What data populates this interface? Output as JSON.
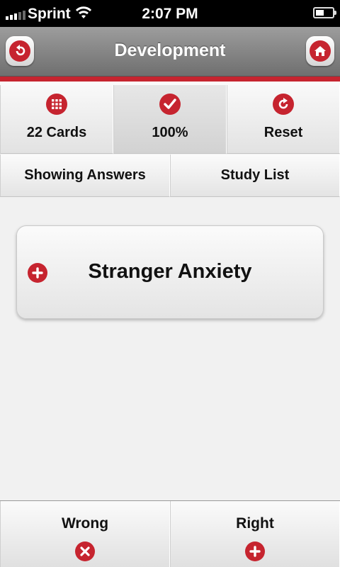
{
  "status_bar": {
    "carrier": "Sprint",
    "time": "2:07 PM"
  },
  "header": {
    "title": "Development",
    "back_icon": "undo-arrow-icon",
    "home_icon": "home-icon"
  },
  "stats": [
    {
      "label": "22 Cards",
      "icon": "grid-icon"
    },
    {
      "label": "100%",
      "icon": "check-icon"
    },
    {
      "label": "Reset",
      "icon": "refresh-icon"
    }
  ],
  "tabs": [
    {
      "label": "Showing Answers"
    },
    {
      "label": "Study List"
    }
  ],
  "card": {
    "term": "Stranger Anxiety",
    "expand_icon": "plus-circle-icon"
  },
  "actions": [
    {
      "label": "Wrong",
      "icon": "x-circle-icon"
    },
    {
      "label": "Right",
      "icon": "plus-circle-icon"
    }
  ],
  "colors": {
    "accent": "#c6242f",
    "header_gray": "#7f7f7f",
    "background": "#f1f1f1"
  }
}
